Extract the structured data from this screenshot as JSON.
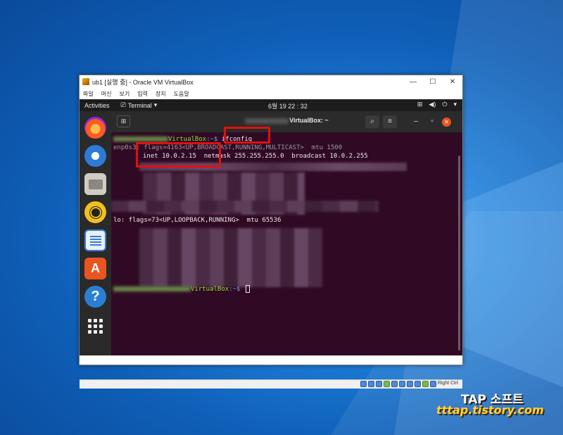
{
  "window": {
    "title": "ub1 [실행 중] - Oracle VM VirtualBox",
    "controls": {
      "minimize": "—",
      "maximize": "☐",
      "close": "✕"
    }
  },
  "menubar": {
    "items": [
      "파일",
      "머신",
      "보기",
      "입력",
      "장치",
      "도움말"
    ]
  },
  "gnome_topbar": {
    "activities": "Activities",
    "app_menu": "Terminal",
    "clock": "6월 19  22 : 32"
  },
  "dock": {
    "icons": [
      "firefox-icon",
      "thunderbird-icon",
      "files-icon",
      "rhythmbox-icon",
      "libreoffice-writer-icon",
      "ubuntu-software-icon",
      "help-icon",
      "show-apps-icon"
    ]
  },
  "terminal": {
    "title_suffix": "VirtualBox: ~",
    "prompt_host": "VirtualBox",
    "prompt_tail": ":~$ ",
    "command": "ifconfig",
    "iface1_prefix": "enp0s3: flags",
    "iface1_flags": "=4163<UP,BROADCAST,RUNNING,MULTICAST>  mtu 1500",
    "inet_line": "inet 10.0.2.15  netmask 255.255.255.0  broadcast 10.0.2.255",
    "lo_line": "lo: flags=73<UP,LOOPBACK,RUNNING>  mtu 65536",
    "final_prompt_host": "VirtualBox",
    "final_prompt_tail": ":~$ "
  },
  "status_bar": {
    "right_ctrl": "Right Ctrl"
  },
  "watermark": {
    "line1": "TAP 소프트",
    "line2": "tttap.tistory.com"
  },
  "colors": {
    "terminal_bg": "#300a24",
    "highlight": "#e01010",
    "ubuntu_orange": "#e95420"
  }
}
